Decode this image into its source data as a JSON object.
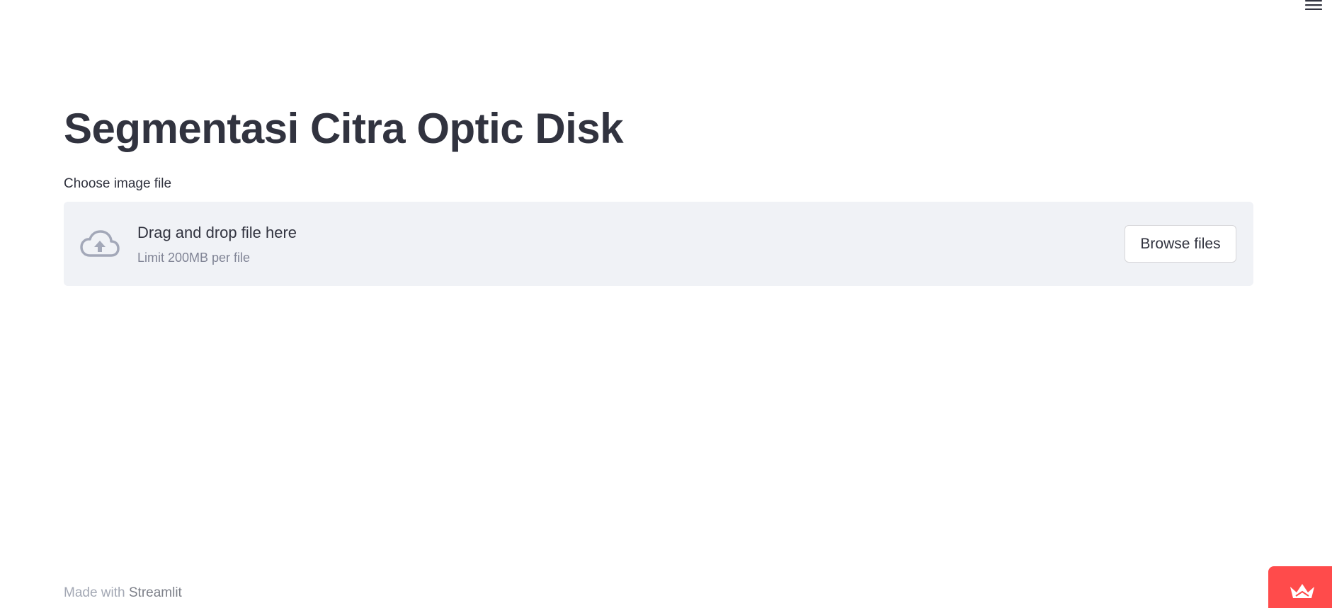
{
  "header": {
    "menu_icon": "hamburger-menu-icon"
  },
  "main": {
    "title": "Segmentasi Citra Optic Disk",
    "uploader": {
      "label": "Choose image file",
      "icon": "cloud-upload-icon",
      "drop_text": "Drag and drop file here",
      "limit_text": "Limit 200MB per file",
      "browse_button": "Browse files"
    }
  },
  "footer": {
    "prefix": "Made with ",
    "link": "Streamlit"
  },
  "badge": {
    "icon": "streamlit-crown-icon"
  },
  "colors": {
    "text": "#31333f",
    "dropzone_bg": "#f0f2f6",
    "badge_bg": "#ff4b4b",
    "icon_gray": "#a3a8b8"
  }
}
